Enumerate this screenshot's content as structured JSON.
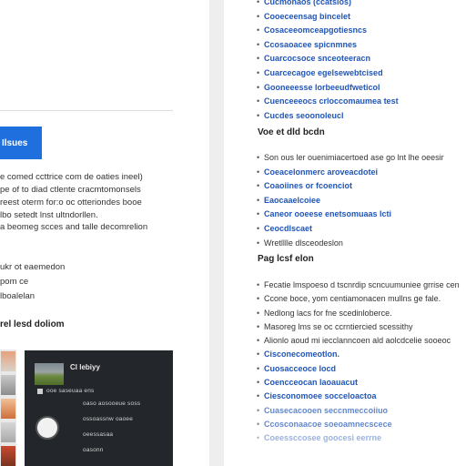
{
  "left": {
    "button_label": "Ilsues",
    "paragraph": [
      "e comed ccttrice com de oaties ineel)",
      "pe of to diad ctlente cracmtomonsels",
      "reest oterm for:o oc otteriondes booe",
      "lbo setedt lnst ultndorllen.",
      "a beomeg scces and talle decomrelion"
    ],
    "short_lines": [
      "ukr ot eaemedon",
      "pom ce",
      "lboalelan"
    ],
    "section_heading": "rel lesd doliom",
    "preview": {
      "title": "Cl lebiyy",
      "rows": [
        "ooe saseuaa ens",
        "oaso aosooeue soss",
        "ossoassnw  oaoee",
        "oeessasaa",
        "oasonn"
      ]
    }
  },
  "right": {
    "top_links": [
      "Cucmonaos (ccatsios)",
      "Cooeceensag bincelet",
      "Cosaceeomceapgotiesncs",
      "Ccosaoacee spicnmnes",
      "Cuarcocsoce snceoteeracn",
      "Cuarcecagoe egelsewebtcised",
      "Gooneeesse lorbeeudfweticol",
      "Cuenceeeocs crloccomaumea test",
      "Cucdes seoonoleucl"
    ],
    "heading1": "Voe et dld bcdn",
    "list1": [
      {
        "text": "Son ous ler ouenimiacertoed ase go lnt lhe oeesir",
        "link": false
      },
      {
        "text": "Coeacelonmerc aroveacdotei",
        "link": true
      },
      {
        "text": "Coaoiines or fcoenciot",
        "link": true
      },
      {
        "text": "Eaocaaelcoiee",
        "link": true
      },
      {
        "text": "Caneor ooeese enetsomuaas lcti",
        "link": true
      },
      {
        "text": "Ceocdlscaet",
        "link": true
      },
      {
        "text": "Wretlllle dlsceodeslon",
        "link": false
      }
    ],
    "heading2": "Pag lcsf elon",
    "list2": [
      {
        "text": "Fecatie lmspoeso d tscnrdip scncuumuniee grrise cen",
        "link": false
      },
      {
        "text": "Ccone boce, yom centiamonacen mullns ge fale.",
        "link": false
      },
      {
        "text": "Nedlong lacs for fne scedinloberce.",
        "link": false
      },
      {
        "text": "Masoreg lms se oc ccrntiercied scessithy",
        "link": false
      },
      {
        "text": "Alionlo aoud mi iecclanncoen ald aolcdcelie sooeoc",
        "link": false
      },
      {
        "text": "Cisconecomeotlon.",
        "link": true
      },
      {
        "text": "Cuosacceoce locd",
        "link": true
      },
      {
        "text": "Coencceocan laoauacut",
        "link": true
      },
      {
        "text": "Ciesconomoee socceloactoa",
        "link": true
      },
      {
        "text": "Cuasecacooen seccnmeccoiiuo",
        "link": true
      },
      {
        "text": "Ccosconaacoe soeoamnecscece",
        "link": true
      },
      {
        "text": "Coeessccosee goocesi eerrne",
        "link": true
      }
    ]
  }
}
